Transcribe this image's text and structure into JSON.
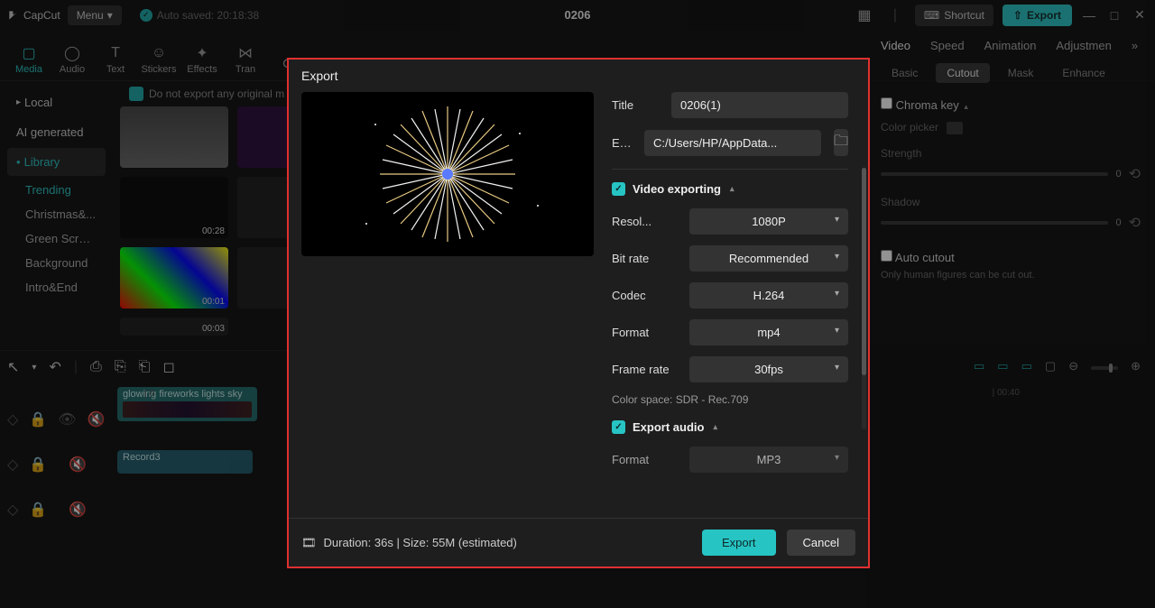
{
  "app": {
    "name": "CapCut",
    "menu": "Menu",
    "auto_saved": "Auto saved: 20:18:38",
    "project": "0206"
  },
  "topbar": {
    "shortcut": "Shortcut",
    "export": "Export"
  },
  "tooltabs": [
    "Media",
    "Audio",
    "Text",
    "Stickers",
    "Effects",
    "Transitions"
  ],
  "sidebar": {
    "local": "Local",
    "ai": "AI generated",
    "library": "Library",
    "subs": [
      "Trending",
      "Christmas&...",
      "Green Screen",
      "Background",
      "Intro&End"
    ]
  },
  "banner": "Do not export any original m",
  "thumbs": [
    {
      "dur": ""
    },
    {
      "dur": ""
    },
    {
      "dur": "00:28"
    },
    {
      "dur": ""
    },
    {
      "dur": "00:01"
    },
    {
      "dur": ""
    },
    {
      "dur": "00:03"
    }
  ],
  "inspector": {
    "tabs": [
      "Video",
      "Speed",
      "Animation",
      "Adjustmen"
    ],
    "subtabs": [
      "Basic",
      "Cutout",
      "Mask",
      "Enhance"
    ],
    "chroma": "Chroma key",
    "picker": "Color picker",
    "strength": "Strength",
    "shadow": "Shadow",
    "auto_cutout": "Auto cutout",
    "auto_hint": "Only human figures can be cut out.",
    "zero": "0"
  },
  "timeline": {
    "clip_title": "glowing fireworks lights sky",
    "record": "Record3",
    "ruler_tick": "| 00:40"
  },
  "player": "Player",
  "modal": {
    "title": "Export",
    "fields": {
      "title_label": "Title",
      "title_value": "0206(1)",
      "exportto_label": "Export to",
      "exportto_value": "C:/Users/HP/AppData..."
    },
    "video_exporting": "Video exporting",
    "rows": {
      "resolution_label": "Resol...",
      "resolution_value": "1080P",
      "bitrate_label": "Bit rate",
      "bitrate_value": "Recommended",
      "codec_label": "Codec",
      "codec_value": "H.264",
      "format_label": "Format",
      "format_value": "mp4",
      "framerate_label": "Frame rate",
      "framerate_value": "30fps"
    },
    "colorspace": "Color space: SDR - Rec.709",
    "export_audio": "Export audio",
    "audio_format_label": "Format",
    "audio_format_value": "MP3",
    "duration": "Duration: 36s | Size: 55M (estimated)",
    "export_btn": "Export",
    "cancel_btn": "Cancel"
  }
}
